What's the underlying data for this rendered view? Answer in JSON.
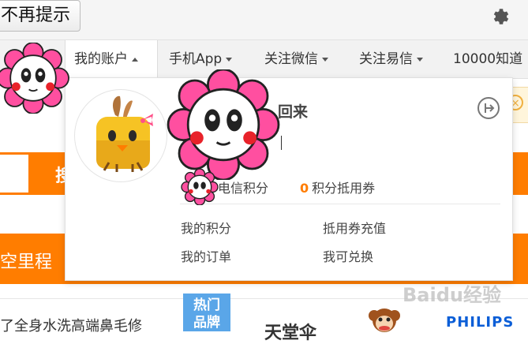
{
  "topbar": {
    "no_remind_label": "不再提示"
  },
  "nav": {
    "items": [
      {
        "label": "我的账户"
      },
      {
        "label": "手机App"
      },
      {
        "label": "关注微信"
      },
      {
        "label": "关注易信"
      },
      {
        "label": "10000知道"
      }
    ]
  },
  "account": {
    "welcome": "回来",
    "points_label": "电信积分",
    "voucher_value": "0",
    "voucher_label": "积分抵用券",
    "links": [
      "我的积分",
      "抵用券充值",
      "我的订单",
      "我可兑换"
    ]
  },
  "page": {
    "search_button": "搜",
    "band_text": "空里程",
    "bottom_text": "了全身水洗高端鼻毛修",
    "hot_badge": [
      "热门",
      "品牌"
    ],
    "brand_text": "天堂伞",
    "brand_philips": "PHILIPS",
    "watermark": "Baidu经验"
  },
  "colors": {
    "accent": "#ff7d00",
    "flower_pink": "#ff4fa0",
    "badge": "#5aa6e8"
  },
  "icons": [
    "settings-gear-icon",
    "caret-down-icon",
    "caret-up-icon",
    "logout-icon",
    "close-icon"
  ]
}
